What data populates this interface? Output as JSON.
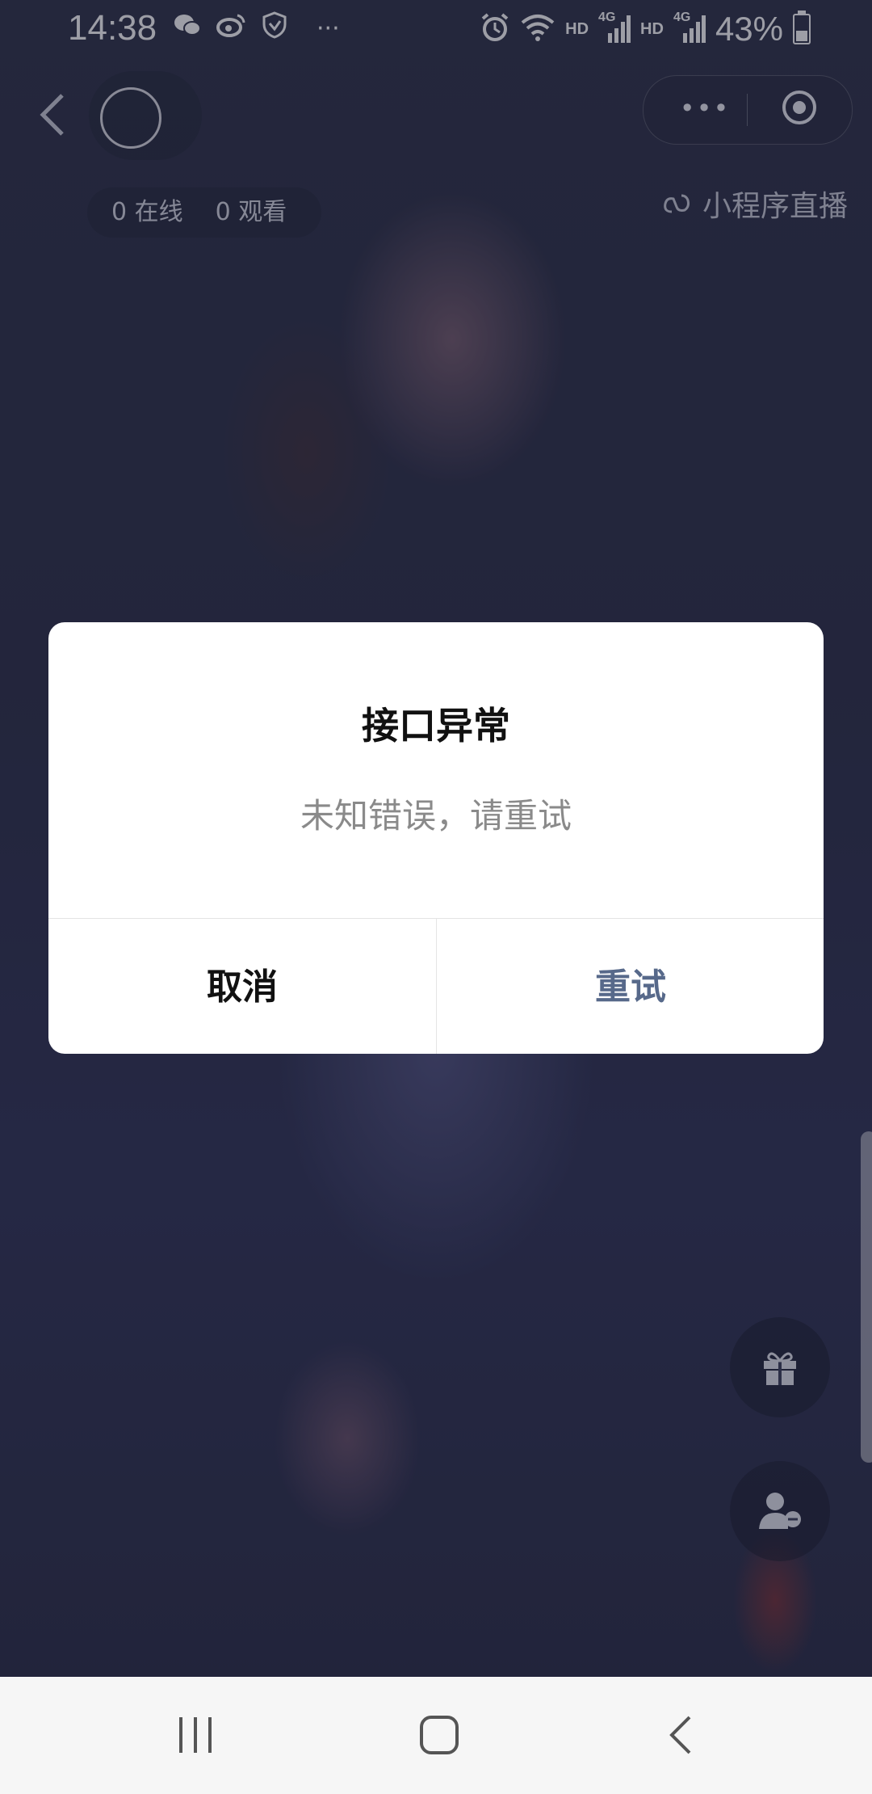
{
  "status_bar": {
    "time": "14:38",
    "left_icons": [
      "wechat-icon",
      "weibo-icon",
      "shield-icon"
    ],
    "more": "···",
    "network_1": "HD",
    "network_2": "HD",
    "signal_label_1": "4G",
    "signal_label_2": "4G",
    "battery": "43%"
  },
  "header": {
    "more_label": "•••",
    "online_count": "0 在线",
    "view_count": "0 观看",
    "mini_program_label": "小程序直播"
  },
  "dialog": {
    "title": "接口异常",
    "message": "未知错误，请重试",
    "cancel_label": "取消",
    "retry_label": "重试"
  },
  "colors": {
    "retry_accent": "#57698a",
    "dialog_bg": "#ffffff",
    "backdrop": "#2a2d44"
  },
  "floating_buttons": [
    "gift-icon",
    "user-minus-icon"
  ],
  "navigation": [
    "recents-icon",
    "home-icon",
    "back-icon"
  ]
}
